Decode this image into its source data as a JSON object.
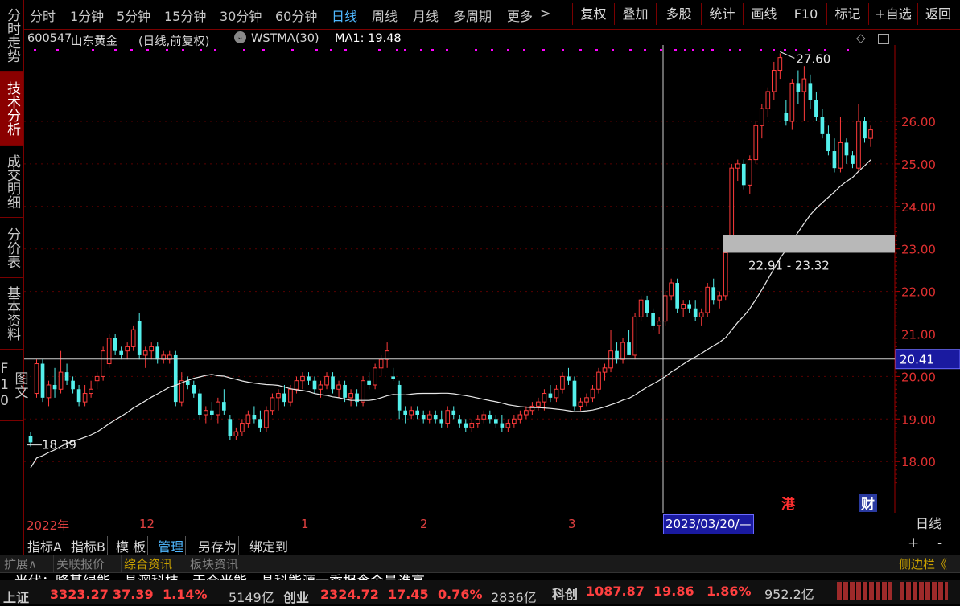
{
  "left_tabs": [
    "分时走势",
    "技术分析",
    "成交明细",
    "分价表",
    "基本资料",
    "图文F10"
  ],
  "toolbar": {
    "periods": [
      "分时",
      "1分钟",
      "5分钟",
      "15分钟",
      "30分钟",
      "60分钟",
      "日线",
      "周线",
      "月线",
      "多周期",
      "更多"
    ],
    "more_arrow": ">",
    "actions": [
      "复权",
      "叠加",
      "多股",
      "统计",
      "画线",
      "F10",
      "标记",
      "+自选",
      "返回"
    ]
  },
  "chart_header": {
    "code": "600547",
    "name": "山东黄金",
    "mode": "(日线,前复权)",
    "indicator": "WSTMA(30)",
    "ma_label": "MA1: 19.48"
  },
  "chart_data": {
    "type": "candlestick",
    "y_ticks": [
      "26.00",
      "25.00",
      "24.00",
      "23.00",
      "22.00",
      "21.00",
      "20.00",
      "19.00",
      "18.00"
    ],
    "ylim": [
      17.3,
      27.8
    ],
    "x_labels": [
      "2022年",
      "12",
      "1",
      "2",
      "3"
    ],
    "current_price": "20.41",
    "crosshair_date": "2023/03/20/—",
    "annotations": {
      "high": "27.60",
      "low": "18.39",
      "gap": "22.91 - 23.32"
    },
    "markers": [
      "港",
      "财"
    ],
    "period_label": "日线",
    "colors": {
      "up": "#ff3b3b",
      "down": "#54f0ec",
      "ma": "#e8e8e8",
      "dots": "#ff00ff"
    }
  },
  "indicator_tabs": [
    "指标A",
    "指标B",
    "模 板",
    "管理",
    "另存为",
    "绑定到"
  ],
  "indicator_controls": [
    "+",
    "-"
  ],
  "info_tabs": [
    "扩展∧",
    "关联报价",
    "综合资讯",
    "板块资讯"
  ],
  "sidebar_toggle": "侧边栏《",
  "news": "光伏：隆基绿能、晶澳科技、天合光能、晶科能源一季报含金量谁高",
  "market": [
    {
      "name": "上证",
      "price": "3323.27",
      "change": "37.39",
      "pct": "1.14%",
      "amount": "5149亿"
    },
    {
      "name": "创业",
      "price": "2324.72",
      "change": "17.45",
      "pct": "0.76%",
      "amount": "2836亿"
    },
    {
      "name": "科创",
      "price": "1087.87",
      "change": "19.86",
      "pct": "1.86%",
      "amount": "952.2亿"
    }
  ]
}
